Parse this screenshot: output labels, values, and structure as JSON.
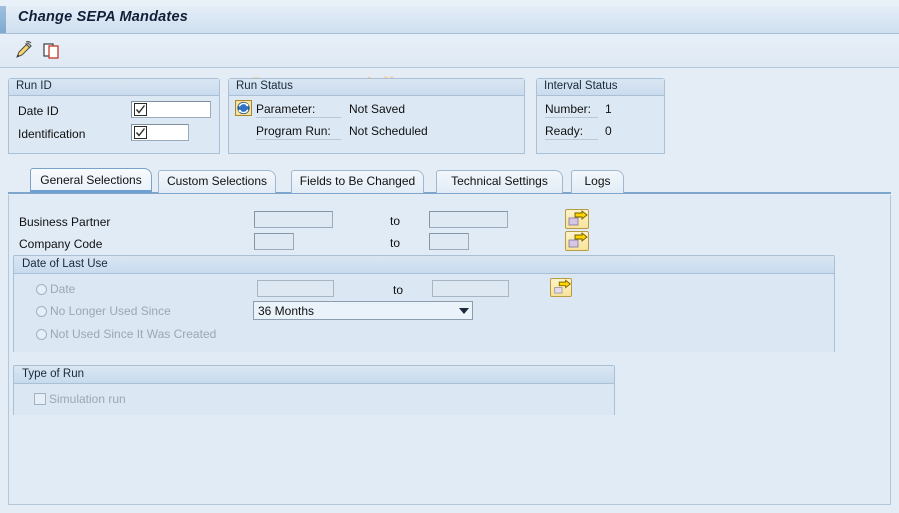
{
  "window": {
    "title": "Change SEPA Mandates"
  },
  "toolbar": {
    "buttons": [
      {
        "name": "edit-icon",
        "label": "Change",
        "icon": "pencil-icon"
      },
      {
        "name": "copy-icon",
        "label": "Copy",
        "icon": "copy-icon"
      }
    ]
  },
  "watermark": {
    "text": "© www.tutorialkart.com",
    "color": "#f3cfa3"
  },
  "run_id_panel": {
    "title": "Run ID",
    "fields": [
      {
        "label": "Date ID",
        "value": "",
        "icon": "checkbox-check-icon"
      },
      {
        "label": "Identification",
        "value": "",
        "icon": "checkbox-check-icon"
      }
    ]
  },
  "run_status_panel": {
    "title": "Run Status",
    "icon": "refresh-status-icon",
    "rows": [
      {
        "label": "Parameter:",
        "value": "Not Saved"
      },
      {
        "label": "Program Run:",
        "value": "Not Scheduled"
      }
    ]
  },
  "interval_status_panel": {
    "title": "Interval Status",
    "rows": [
      {
        "label": "Number:",
        "value": "1"
      },
      {
        "label": "Ready:",
        "value": "0"
      }
    ]
  },
  "tabs": [
    {
      "label": "General Selections",
      "active": true
    },
    {
      "label": "Custom Selections",
      "active": false
    },
    {
      "label": "Fields to Be Changed",
      "active": false
    },
    {
      "label": "Technical Settings",
      "active": false
    },
    {
      "label": "Logs",
      "active": false
    }
  ],
  "selection_rows": [
    {
      "label": "Business Partner",
      "from_value": "",
      "to_label": "to",
      "to_value": "",
      "multi_select_icon": "multi-select-arrow-icon"
    },
    {
      "label": "Company Code",
      "from_value": "",
      "to_label": "to",
      "to_value": "",
      "multi_select_icon": "multi-select-arrow-icon"
    }
  ],
  "date_of_last_use": {
    "title": "Date of Last Use",
    "options": [
      {
        "label": "Date",
        "selected": false,
        "enabled": false
      },
      {
        "label": "No Longer Used Since",
        "selected": false,
        "enabled": false
      },
      {
        "label": "Not Used Since It Was Created",
        "selected": false,
        "enabled": false
      }
    ],
    "date_from": "",
    "to_label": "to",
    "date_to": "",
    "multi_select_icon": "multi-select-arrow-icon",
    "period_dropdown": {
      "value": "36 Months",
      "options": [
        "36 Months"
      ]
    }
  },
  "type_of_run": {
    "title": "Type of Run",
    "checkbox": {
      "label": "Simulation run",
      "checked": false,
      "enabled": false
    }
  },
  "colors": {
    "title_text": "#121f38",
    "panel_bg": "#dce8f4",
    "content_bg": "#e1ebf5",
    "border": "#a9c0d6",
    "tab_active_underline": "#6f9fd0",
    "accent_yellow": "#f6e49a"
  }
}
